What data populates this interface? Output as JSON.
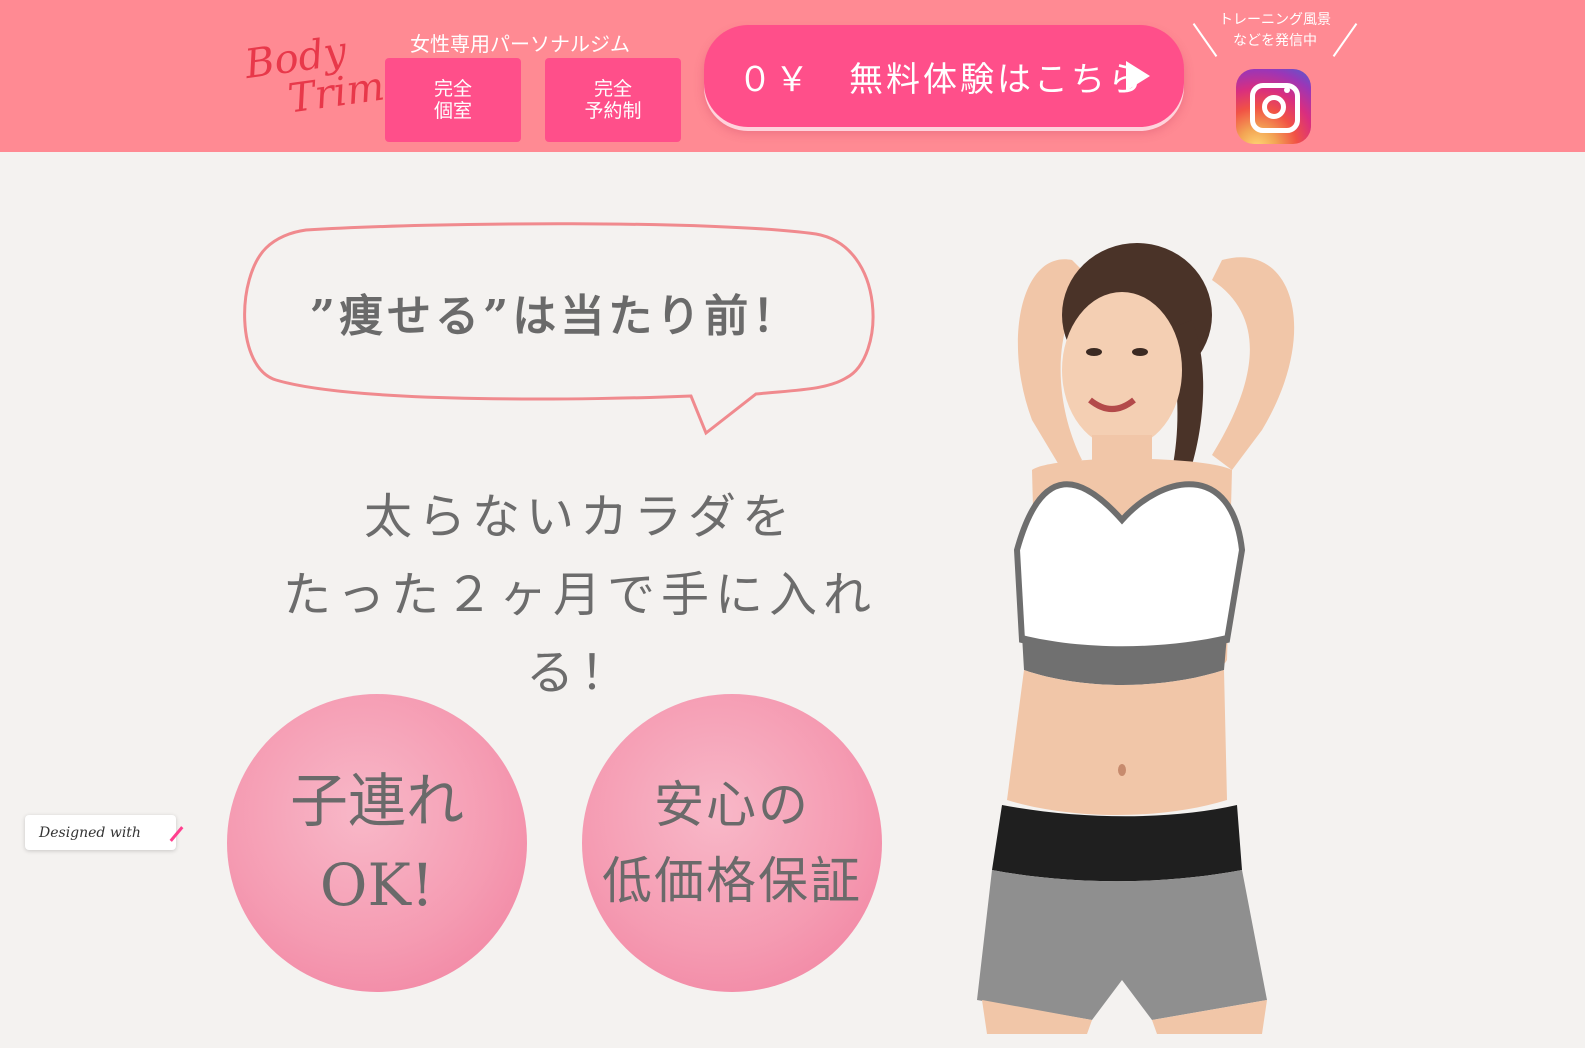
{
  "header": {
    "logo_line1": "Body",
    "logo_line2": "Trim",
    "tagline": "女性専用パーソナルジム",
    "feature1": [
      "完全",
      "個室"
    ],
    "feature2": [
      "完全",
      "予約制"
    ],
    "cta_label": "０￥　無料体験はこちら",
    "instagram_caption": [
      "トレーニング風景",
      "などを発信中"
    ],
    "colors": {
      "header_bg": "#ff8a93",
      "accent": "#ff4f8a"
    }
  },
  "hero": {
    "bubble_text": "”痩せる”は当たり前！",
    "headline_line1": "太らないカラダを",
    "headline_line2": "たった２ヶ月で手に入れる！",
    "circle1": [
      "子連れ",
      "OK!"
    ],
    "circle2": [
      "安心の",
      "低価格保証"
    ]
  },
  "badge": {
    "designed_with": "Designed with"
  },
  "icons": {
    "cta": "play-arrow-icon",
    "social": "instagram-icon"
  }
}
